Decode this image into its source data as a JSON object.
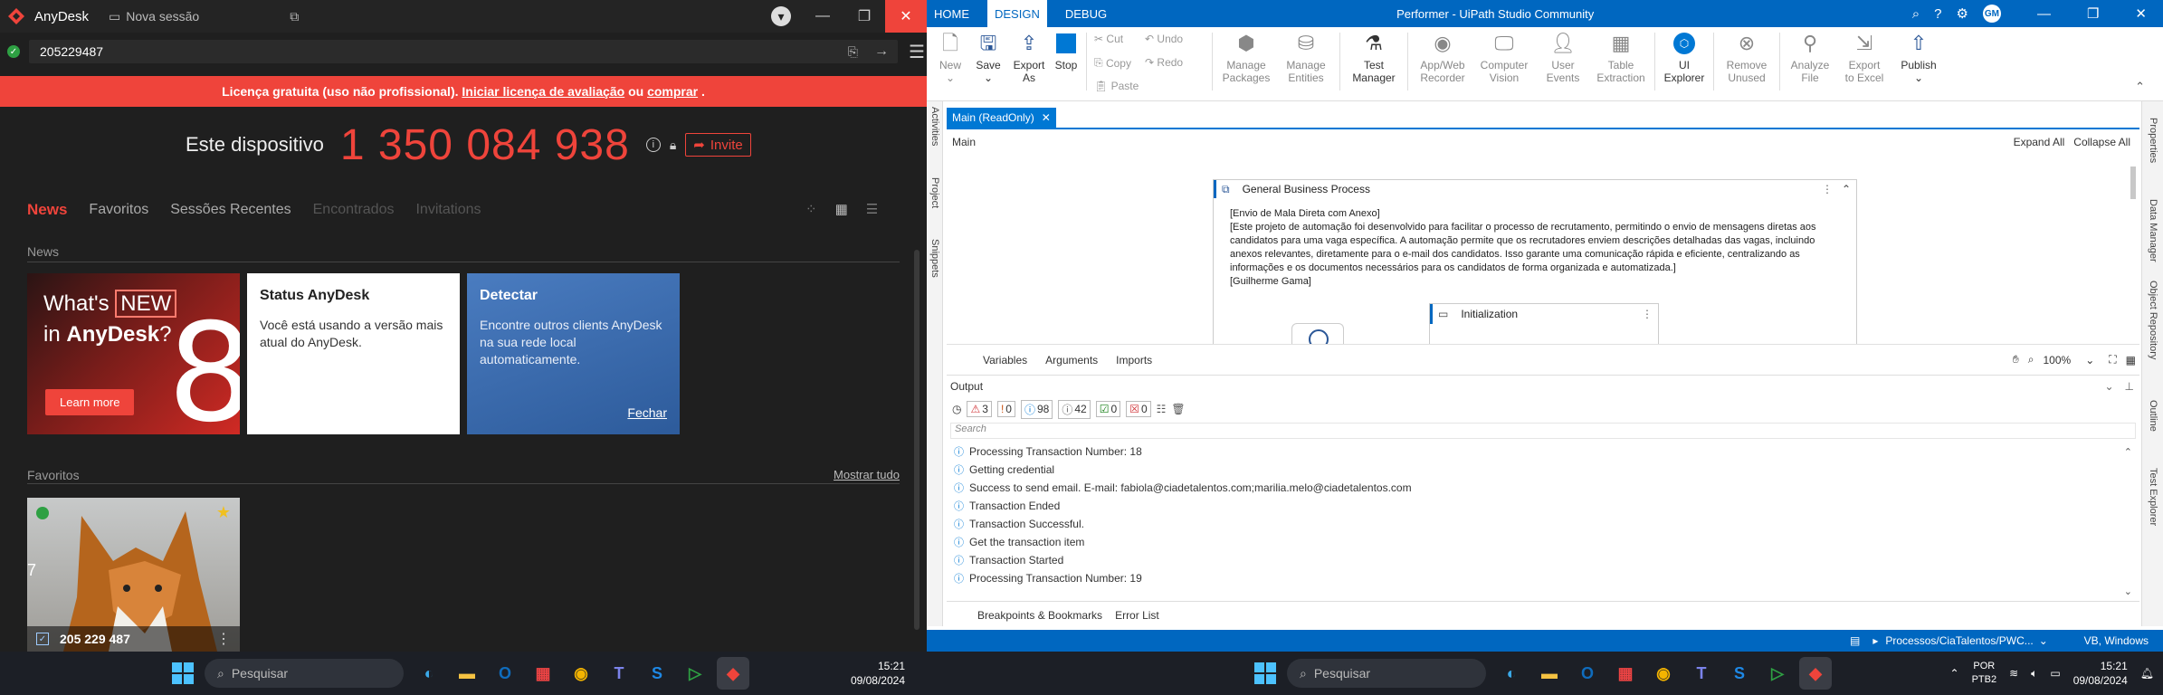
{
  "anydesk": {
    "title": "AnyDesk",
    "new_session": "Nova sessão",
    "address_value": "205229487",
    "license_text": "Licença gratuita (uso não profissional).",
    "license_link1": "Iniciar licença de avaliação",
    "license_or": "ou",
    "license_link2": "comprar",
    "license_end": ".",
    "this_device_label": "Este dispositivo",
    "device_id": "1 350 084 938",
    "invite_label": "Invite",
    "tabs": [
      "News",
      "Favoritos",
      "Sessões Recentes",
      "Encontrados",
      "Invitations"
    ],
    "news_header": "News",
    "card1": {
      "line1": "What's",
      "new_badge": "NEW",
      "line2_pre": "in",
      "line2_brand": "AnyDesk",
      "line2_q": "?",
      "big": "8",
      "button": "Learn more"
    },
    "card2": {
      "title": "Status AnyDesk",
      "body": "Você está usando a versão mais atual do AnyDesk."
    },
    "card3": {
      "title": "Detectar",
      "body": "Encontre outros clients AnyDesk na sua rede local automaticamente.",
      "link": "Fechar"
    },
    "favorites_header": "Favoritos",
    "show_all": "Mostrar tudo",
    "fav_item": {
      "id": "205 229 487",
      "side_text": "7"
    }
  },
  "taskbar_left": {
    "search": "Pesquisar",
    "time": "15:21",
    "date": "09/08/2024"
  },
  "uipath": {
    "title": "Performer - UiPath Studio Community",
    "user_initials": "GM",
    "menu": [
      "HOME",
      "DESIGN",
      "DEBUG"
    ],
    "active_menu": "DESIGN",
    "ribbon": [
      {
        "label": "New",
        "sub": "",
        "icon": "new-file-icon"
      },
      {
        "label": "Save",
        "sub": "",
        "icon": "save-icon"
      },
      {
        "label": "Export",
        "sub": "As",
        "icon": "export-icon"
      },
      {
        "label": "Stop",
        "sub": "",
        "icon": "stop-icon"
      }
    ],
    "clip": {
      "cut": "Cut",
      "copy": "Copy",
      "paste": "Paste",
      "undo": "Undo",
      "redo": "Redo"
    },
    "ribbon2": [
      {
        "label": "Manage",
        "sub": "Packages"
      },
      {
        "label": "Manage",
        "sub": "Entities"
      },
      {
        "label": "Test",
        "sub": "Manager"
      },
      {
        "label": "App/Web",
        "sub": "Recorder"
      },
      {
        "label": "Computer",
        "sub": "Vision"
      },
      {
        "label": "User",
        "sub": "Events"
      },
      {
        "label": "Table",
        "sub": "Extraction"
      },
      {
        "label": "UI",
        "sub": "Explorer"
      },
      {
        "label": "Remove",
        "sub": "Unused"
      },
      {
        "label": "Analyze",
        "sub": "File"
      },
      {
        "label": "Export",
        "sub": "to Excel"
      },
      {
        "label": "Publish",
        "sub": ""
      }
    ],
    "left_side": [
      "Activities",
      "Project",
      "Snippets"
    ],
    "right_side": [
      "Properties",
      "Data Manager",
      "Object Repository",
      "Outline",
      "Test Explorer"
    ],
    "doc_tab": "Main (ReadOnly)",
    "breadcrumb": "Main",
    "expand_all": "Expand All",
    "collapse_all": "Collapse All",
    "gbp_title": "General Business Process",
    "gbp_annotation": "[Envio de Mala Direta com Anexo]\n[Este projeto de automação foi desenvolvido para facilitar o processo de recrutamento, permitindo o envio de mensagens diretas aos candidatos para uma vaga específica. A automação permite que os recrutadores enviem descrições detalhadas das vagas, incluindo anexos relevantes, diretamente para o e-mail dos candidatos. Isso garante uma comunicação rápida e eficiente, centralizando as informações e os documentos necessários para os candidatos de forma organizada e automatizada.]\n[Guilherme Gama]",
    "init_title": "Initialization",
    "bottom_tabs": [
      "Variables",
      "Arguments",
      "Imports"
    ],
    "zoom": "100%",
    "output_title": "Output",
    "filters": [
      {
        "count": "3",
        "color": "#d13438"
      },
      {
        "count": "0",
        "color": "#ca5010"
      },
      {
        "count": "98",
        "color": "#0078d4"
      },
      {
        "count": "42",
        "color": "#555"
      },
      {
        "count": "0",
        "color": "#107c10"
      },
      {
        "count": "0",
        "color": "#d13438"
      }
    ],
    "search_placeholder": "Search",
    "log": [
      "Processing Transaction Number: 18",
      "Getting credential",
      "Success to send email. E-mail: fabiola@ciadetalentos.com;marilia.melo@ciadetalentos.com",
      "Transaction Ended",
      "Transaction Successful.",
      "Get the transaction item",
      "Transaction Started",
      "Processing Transaction Number: 19"
    ],
    "panel_tabs": [
      "Breakpoints & Bookmarks",
      "Error List"
    ],
    "status_path": "Processos/CiaTalentos/PWC...",
    "status_right": "VB, Windows"
  },
  "taskbar_right": {
    "search": "Pesquisar",
    "lang1": "POR",
    "lang2": "PTB2",
    "time": "15:21",
    "date": "09/08/2024"
  },
  "colors": {
    "anydesk_red": "#ef443b",
    "uipath_blue": "#0067c0",
    "card_blue": "#3d6fb4"
  }
}
